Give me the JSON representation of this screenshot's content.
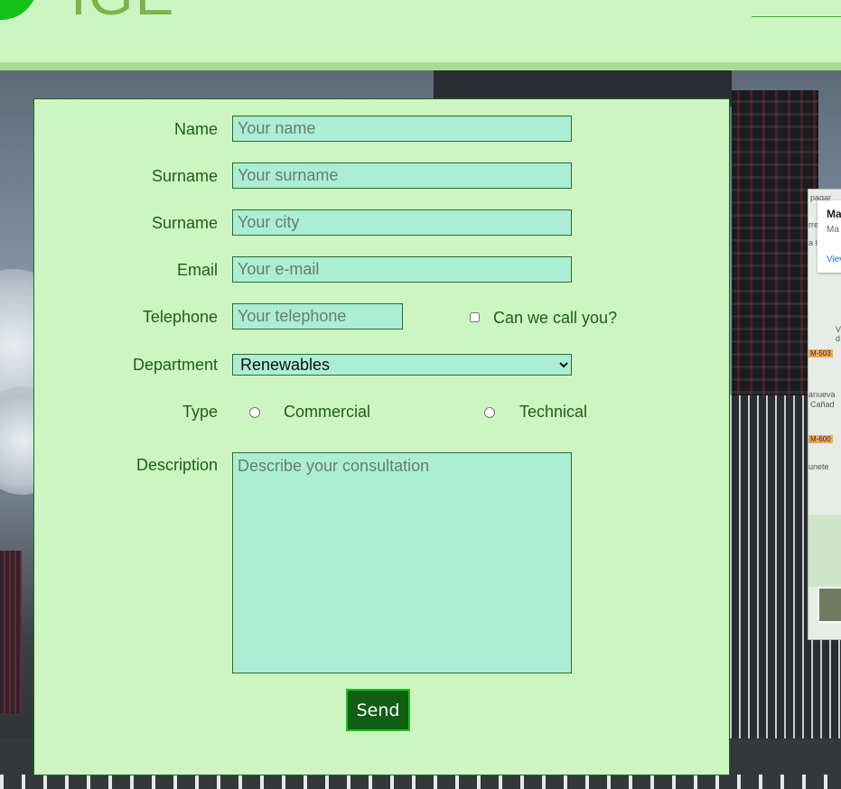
{
  "header": {
    "logo_text": "IGE"
  },
  "form": {
    "name": {
      "label": "Name",
      "placeholder": "Your name",
      "value": ""
    },
    "surname": {
      "label": "Surname",
      "placeholder": "Your surname",
      "value": ""
    },
    "city": {
      "label": "Surname",
      "placeholder": "Your city",
      "value": ""
    },
    "email": {
      "label": "Email",
      "placeholder": "Your e-mail",
      "value": ""
    },
    "telephone": {
      "label": "Telephone",
      "placeholder": "Your telephone",
      "value": ""
    },
    "call_checkbox": {
      "label": "Can we call you?",
      "checked": false
    },
    "department": {
      "label": "Department",
      "selected": "Renewables"
    },
    "type": {
      "label": "Type",
      "options": [
        "Commercial",
        "Technical"
      ]
    },
    "description": {
      "label": "Description",
      "placeholder": "Describe your consultation"
    },
    "send_label": "Send"
  },
  "map": {
    "title": "Ma",
    "subtitle": "Ma",
    "link": "Viev",
    "labels": [
      "pagar",
      "rrej",
      "a l",
      "M-503",
      "V",
      "d",
      "anueva",
      "Cañad",
      "M-600",
      "unete"
    ]
  },
  "colors": {
    "panel_bg": "#cdf5c2",
    "input_bg": "#abeed5",
    "label_text": "#1a5f1a",
    "button_bg": "#0f5e14",
    "button_border": "#19c41f"
  }
}
